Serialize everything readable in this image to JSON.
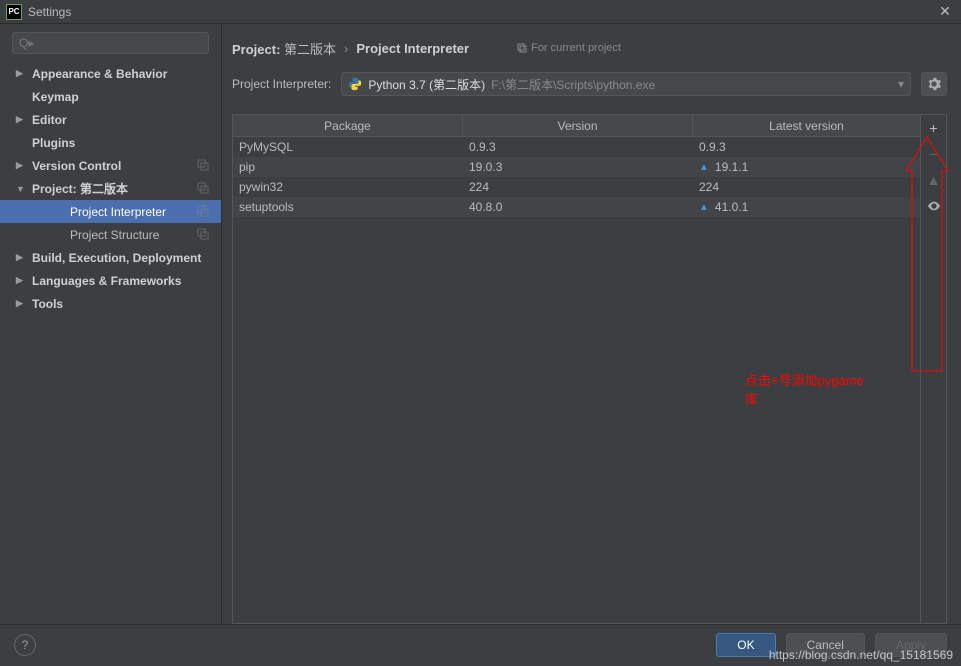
{
  "window": {
    "app_icon_text": "PC",
    "title": "Settings"
  },
  "search": {
    "placeholder": "Q▸"
  },
  "sidebar": {
    "items": [
      {
        "label": "Appearance & Behavior",
        "arrow": "▶",
        "bold": true,
        "copy": false
      },
      {
        "label": "Keymap",
        "arrow": "",
        "bold": true,
        "copy": false
      },
      {
        "label": "Editor",
        "arrow": "▶",
        "bold": true,
        "copy": false
      },
      {
        "label": "Plugins",
        "arrow": "",
        "bold": true,
        "copy": false
      },
      {
        "label": "Version Control",
        "arrow": "▶",
        "bold": true,
        "copy": true
      },
      {
        "label": "Project: 第二版本",
        "arrow": "▼",
        "bold": true,
        "copy": true
      },
      {
        "label": "Project Interpreter",
        "arrow": "",
        "bold": false,
        "copy": true,
        "selected": true,
        "indent": "grandchild"
      },
      {
        "label": "Project Structure",
        "arrow": "",
        "bold": false,
        "copy": true,
        "indent": "grandchild"
      },
      {
        "label": "Build, Execution, Deployment",
        "arrow": "▶",
        "bold": true,
        "copy": false
      },
      {
        "label": "Languages & Frameworks",
        "arrow": "▶",
        "bold": true,
        "copy": false
      },
      {
        "label": "Tools",
        "arrow": "▶",
        "bold": true,
        "copy": false
      }
    ]
  },
  "breadcrumb": {
    "prefix": "Project:",
    "project": "第二版本",
    "separator": "›",
    "node": "Project Interpreter",
    "hint": "For current project"
  },
  "interpreter": {
    "label": "Project Interpreter:",
    "name": "Python 3.7 (第二版本)",
    "path": "F:\\第二版本\\Scripts\\python.exe"
  },
  "table": {
    "headers": {
      "pkg": "Package",
      "ver": "Version",
      "lat": "Latest version"
    },
    "rows": [
      {
        "pkg": "PyMySQL",
        "ver": "0.9.3",
        "lat": "0.9.3",
        "upgrade": false
      },
      {
        "pkg": "pip",
        "ver": "19.0.3",
        "lat": "19.1.1",
        "upgrade": true
      },
      {
        "pkg": "pywin32",
        "ver": "224",
        "lat": "224",
        "upgrade": false
      },
      {
        "pkg": "setuptools",
        "ver": "40.8.0",
        "lat": "41.0.1",
        "upgrade": true
      }
    ]
  },
  "buttons": {
    "ok": "OK",
    "cancel": "Cancel",
    "apply": "Apply"
  },
  "annotation": {
    "text": "点击+号添加pygame库"
  },
  "watermark": "https://blog.csdn.net/qq_15181569"
}
